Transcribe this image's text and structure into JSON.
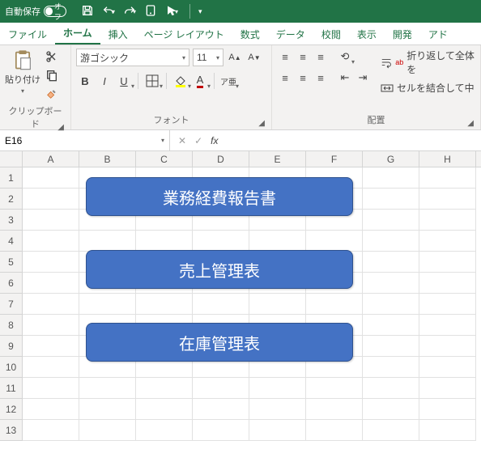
{
  "titlebar": {
    "autosave_label": "自動保存",
    "autosave_state": "オフ"
  },
  "tabs": {
    "file": "ファイル",
    "home": "ホーム",
    "insert": "挿入",
    "pagelayout": "ページ レイアウト",
    "formulas": "数式",
    "data": "データ",
    "review": "校閲",
    "view": "表示",
    "developer": "開発",
    "addin": "アド"
  },
  "ribbon": {
    "clipboard": {
      "paste": "貼り付け",
      "group_label": "クリップボード"
    },
    "font": {
      "name": "游ゴシック",
      "size": "11",
      "group_label": "フォント",
      "bold": "B",
      "italic": "I",
      "underline": "U"
    },
    "alignment": {
      "wrap": "折り返して全体を",
      "merge": "セルを結合して中",
      "group_label": "配置"
    }
  },
  "namebox": {
    "value": "E16"
  },
  "formula": {
    "value": ""
  },
  "columns": [
    "A",
    "B",
    "C",
    "D",
    "E",
    "F",
    "G",
    "H"
  ],
  "rows": [
    "1",
    "2",
    "3",
    "4",
    "5",
    "6",
    "7",
    "8",
    "9",
    "10",
    "11",
    "12",
    "13"
  ],
  "shapes": {
    "s1": "業務経費報告書",
    "s2": "売上管理表",
    "s3": "在庫管理表"
  },
  "selected": {
    "col": 4,
    "row": 15
  },
  "colors": {
    "brand": "#217346",
    "shape": "#4472c4"
  }
}
